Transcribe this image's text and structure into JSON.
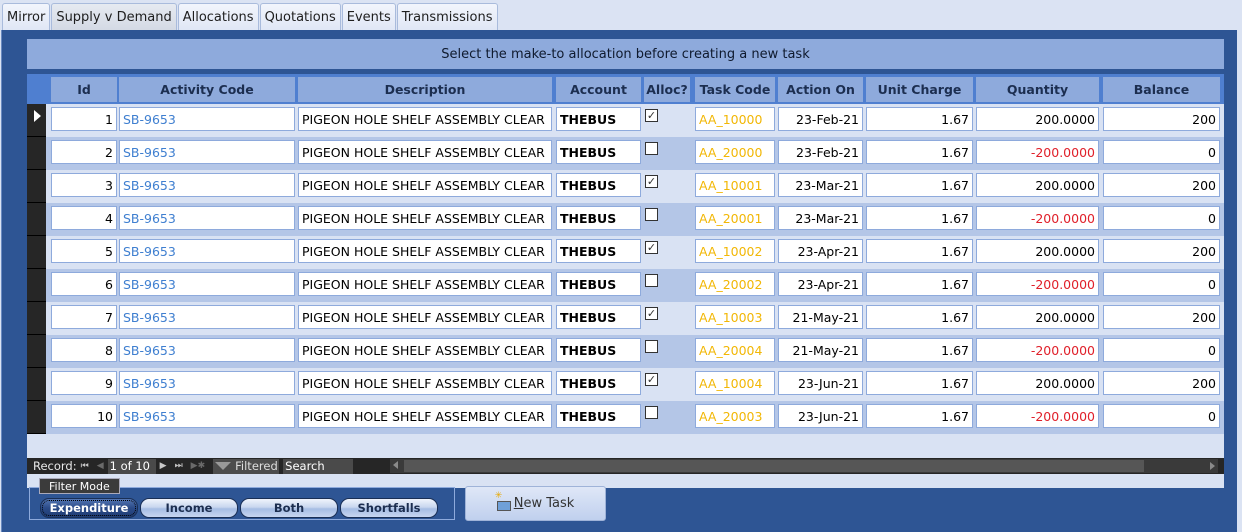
{
  "tabs": [
    {
      "label": "Mirror",
      "active": false
    },
    {
      "label": "Supply v Demand",
      "active": true
    },
    {
      "label": "Allocations",
      "active": false
    },
    {
      "label": "Quotations",
      "active": false
    },
    {
      "label": "Events",
      "active": false
    },
    {
      "label": "Transmissions",
      "active": false
    }
  ],
  "banner": "Select the make-to allocation before creating a new task",
  "columns": [
    "Id",
    "Activity Code",
    "Description",
    "Account",
    "Alloc?",
    "Task Code",
    "Action On",
    "Unit Charge",
    "Quantity",
    "Balance"
  ],
  "rows": [
    {
      "id": "1",
      "activity_code": "SB-9653",
      "description": "PIGEON HOLE SHELF ASSEMBLY CLEAR",
      "account": "THEBUS",
      "alloc": true,
      "task_code": "AA_10000",
      "action_on": "23-Feb-21",
      "unit_charge": "1.67",
      "quantity": "200.0000",
      "balance": "200"
    },
    {
      "id": "2",
      "activity_code": "SB-9653",
      "description": "PIGEON HOLE SHELF ASSEMBLY CLEAR",
      "account": "THEBUS",
      "alloc": false,
      "task_code": "AA_20000",
      "action_on": "23-Feb-21",
      "unit_charge": "1.67",
      "quantity": "-200.0000",
      "balance": "0"
    },
    {
      "id": "3",
      "activity_code": "SB-9653",
      "description": "PIGEON HOLE SHELF ASSEMBLY CLEAR",
      "account": "THEBUS",
      "alloc": true,
      "task_code": "AA_10001",
      "action_on": "23-Mar-21",
      "unit_charge": "1.67",
      "quantity": "200.0000",
      "balance": "200"
    },
    {
      "id": "4",
      "activity_code": "SB-9653",
      "description": "PIGEON HOLE SHELF ASSEMBLY CLEAR",
      "account": "THEBUS",
      "alloc": false,
      "task_code": "AA_20001",
      "action_on": "23-Mar-21",
      "unit_charge": "1.67",
      "quantity": "-200.0000",
      "balance": "0"
    },
    {
      "id": "5",
      "activity_code": "SB-9653",
      "description": "PIGEON HOLE SHELF ASSEMBLY CLEAR",
      "account": "THEBUS",
      "alloc": true,
      "task_code": "AA_10002",
      "action_on": "23-Apr-21",
      "unit_charge": "1.67",
      "quantity": "200.0000",
      "balance": "200"
    },
    {
      "id": "6",
      "activity_code": "SB-9653",
      "description": "PIGEON HOLE SHELF ASSEMBLY CLEAR",
      "account": "THEBUS",
      "alloc": false,
      "task_code": "AA_20002",
      "action_on": "23-Apr-21",
      "unit_charge": "1.67",
      "quantity": "-200.0000",
      "balance": "0"
    },
    {
      "id": "7",
      "activity_code": "SB-9653",
      "description": "PIGEON HOLE SHELF ASSEMBLY CLEAR",
      "account": "THEBUS",
      "alloc": true,
      "task_code": "AA_10003",
      "action_on": "21-May-21",
      "unit_charge": "1.67",
      "quantity": "200.0000",
      "balance": "200"
    },
    {
      "id": "8",
      "activity_code": "SB-9653",
      "description": "PIGEON HOLE SHELF ASSEMBLY CLEAR",
      "account": "THEBUS",
      "alloc": false,
      "task_code": "AA_20004",
      "action_on": "21-May-21",
      "unit_charge": "1.67",
      "quantity": "-200.0000",
      "balance": "0"
    },
    {
      "id": "9",
      "activity_code": "SB-9653",
      "description": "PIGEON HOLE SHELF ASSEMBLY CLEAR",
      "account": "THEBUS",
      "alloc": true,
      "task_code": "AA_10004",
      "action_on": "23-Jun-21",
      "unit_charge": "1.67",
      "quantity": "200.0000",
      "balance": "200"
    },
    {
      "id": "10",
      "activity_code": "SB-9653",
      "description": "PIGEON HOLE SHELF ASSEMBLY CLEAR",
      "account": "THEBUS",
      "alloc": false,
      "task_code": "AA_20003",
      "action_on": "23-Jun-21",
      "unit_charge": "1.67",
      "quantity": "-200.0000",
      "balance": "0"
    }
  ],
  "navigation": {
    "record_label": "Record:",
    "record_position": "1 of 10",
    "filtered_label": "Filtered",
    "search_placeholder": "Search"
  },
  "filter_mode": {
    "label": "Filter Mode",
    "buttons": [
      "Expenditure",
      "Income",
      "Both",
      "Shortfalls"
    ],
    "active": "Expenditure"
  },
  "new_task_button": {
    "accel": "N",
    "rest": "ew Task"
  },
  "colors": {
    "panel": "#2e5594",
    "header": "#8eaadc",
    "link": "#3f7fd0",
    "task_code": "#f2b705",
    "negative": "#e0202a"
  }
}
